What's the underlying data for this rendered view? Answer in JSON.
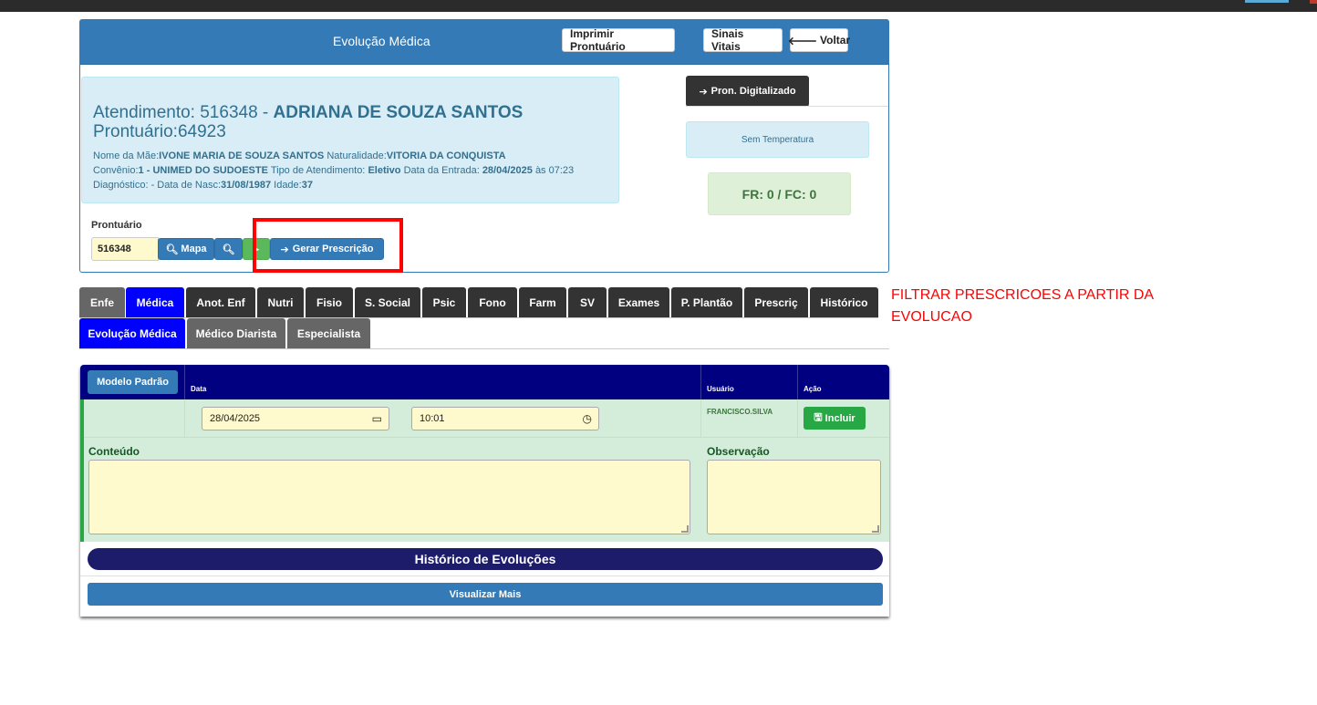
{
  "header": {
    "title": "Evolução Médica",
    "print_button": "Imprimir Prontuário",
    "vitals_button": "Sinais Vitais",
    "back_button": "Voltar"
  },
  "patient": {
    "atendimento_prefix": "Atendimento: 516348 - ",
    "name": "ADRIANA DE SOUZA SANTOS",
    "prontuario": "Prontuário:64923",
    "mae_label": "Nome da Mãe:",
    "mae": "IVONE MARIA DE SOUZA SANTOS",
    "naturalidade_label": "Naturalidade:",
    "naturalidade": "VITORIA DA CONQUISTA",
    "convenio_label": "Convênio:",
    "convenio": "1 - UNIMED DO SUDOESTE",
    "tipo_label": "Tipo de Atendimento:",
    "tipo": "Eletivo",
    "entrada_label": "Data da Entrada:",
    "entrada": "28/04/2025",
    "entrada_hora": "às 07:23",
    "diagnostico": "Diagnóstico: - Data de Nasc:",
    "nascimento": "31/08/1987",
    "idade_label": "Idade:",
    "idade": "37"
  },
  "side": {
    "pron_digitalizado": "Pron. Digitalizado",
    "temperatura": "Sem Temperatura",
    "fr_fc": "FR: 0 / FC: 0"
  },
  "prontuario_search": {
    "label": "Prontuário",
    "value": "516348",
    "mapa_button": "Mapa",
    "gerar_button": "Gerar Prescrição"
  },
  "annotation": "FILTRAR PRESCRICOES A PARTIR DA EVOLUCAO",
  "tabs_row1": [
    "Enfe",
    "Médica",
    "Anot. Enf",
    "Nutri",
    "Fisio",
    "S. Social",
    "Psic",
    "Fono",
    "Farm",
    "SV",
    "Exames",
    "P. Plantão",
    "Prescriç",
    "Histórico"
  ],
  "tabs_row2": [
    "Evolução Médica",
    "Médico Diarista",
    "Especialista"
  ],
  "form": {
    "modelo_button": "Modelo Padrão",
    "col_data": "Data",
    "col_usuario": "Usuário",
    "col_acao": "Ação",
    "date_value": "28/04/2025",
    "time_value": "10:01",
    "usuario": "FRANCISCO.SILVA",
    "incluir_button": "Incluir",
    "conteudo_label": "Conteúdo",
    "observacao_label": "Observação",
    "historico_title": "Histórico de Evoluções",
    "visualizar_button": "Visualizar Mais"
  },
  "colors": {
    "primary": "#337ab7",
    "tab_active": "#0000ff",
    "table_header": "#000080",
    "success": "#28a745",
    "annotation": "#ff0000"
  }
}
